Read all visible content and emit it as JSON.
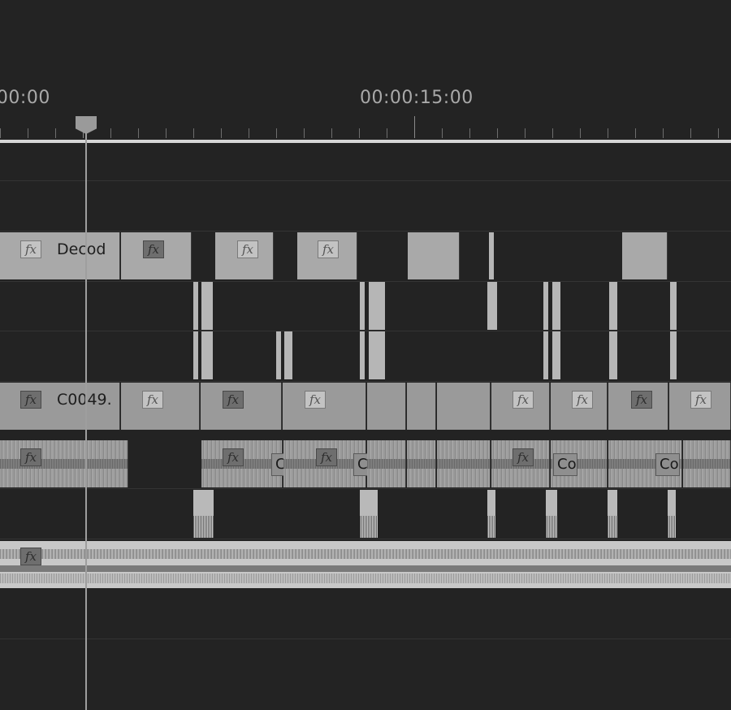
{
  "ruler": {
    "timecode_start": ":00:00",
    "timecode_mid": "00:00:15:00"
  },
  "tracks": {
    "v3_clip_label": "Decod",
    "v1_clip_label": "C0049.",
    "fx_label": "fx",
    "cc_label": "Co"
  },
  "playhead": {
    "time": ""
  }
}
